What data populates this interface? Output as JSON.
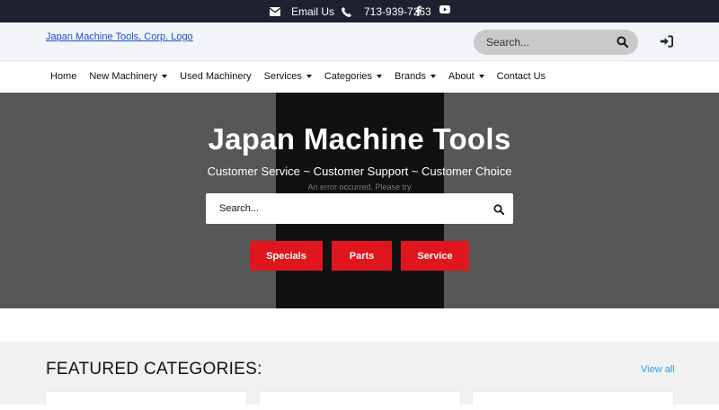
{
  "topbar": {
    "email_label": "Email Us",
    "phone_label": "713-939-7263"
  },
  "header": {
    "logo_alt": "Japan Machine Tools, Corp. Logo",
    "search_placeholder": "Search..."
  },
  "nav": {
    "items": [
      {
        "label": "Home"
      },
      {
        "label": "New Machinery"
      },
      {
        "label": "Used Machinery"
      },
      {
        "label": "Services"
      },
      {
        "label": "Categories"
      },
      {
        "label": "Brands"
      },
      {
        "label": "About"
      },
      {
        "label": "Contact Us"
      }
    ]
  },
  "hero": {
    "title": "Japan Machine Tools",
    "subtitle": "Customer Service ~ Customer Support ~ Customer Choice",
    "error_text": "An error occurred. Please try",
    "search_placeholder": "Search...",
    "buttons": {
      "specials": "Specials",
      "parts": "Parts",
      "service": "Service"
    },
    "button_color": "#e0161e"
  },
  "featured": {
    "heading": "FEATURED CATEGORIES:",
    "view_all": "View all"
  },
  "colors": {
    "topbar_bg": "#1e2130",
    "link_blue": "#1a4fd6",
    "view_all": "#27a3e0"
  }
}
